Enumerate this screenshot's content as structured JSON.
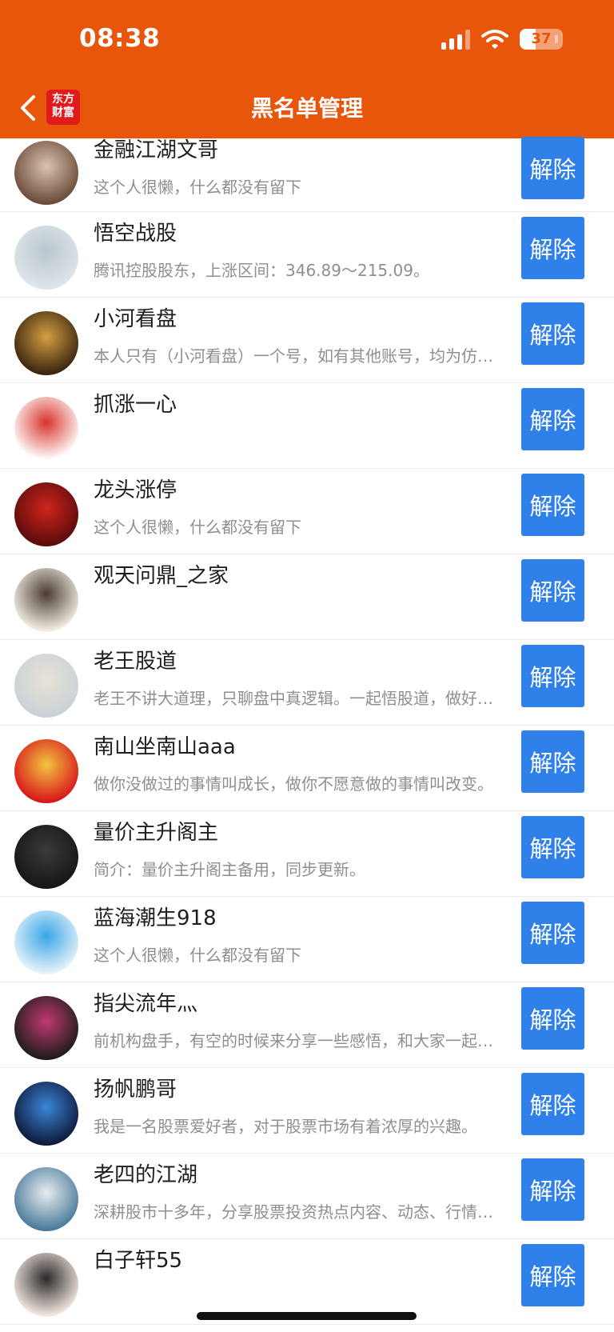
{
  "status": {
    "time": "08:38",
    "battery": "37",
    "battery_level": 0.37
  },
  "header": {
    "title": "黑名单管理",
    "logo_line1": "东方",
    "logo_line2": "财富"
  },
  "button_label": "解除",
  "users": [
    {
      "name": "金融江湖文哥",
      "desc": "这个人很懒，什么都没有留下",
      "avatar_colors": [
        "#6b4a3a",
        "#d9c4b0"
      ]
    },
    {
      "name": "悟空战股",
      "desc": "腾讯控股股东，上涨区间：346.89～215.09。",
      "avatar_colors": [
        "#dfe6ea",
        "#b9c6cf"
      ]
    },
    {
      "name": "小河看盘",
      "desc": "本人只有（小河看盘）一个号，如有其他账号，均为仿冒。",
      "avatar_colors": [
        "#3a2410",
        "#d4a040"
      ]
    },
    {
      "name": "抓涨一心",
      "desc": "",
      "avatar_colors": [
        "#ffffff",
        "#d8342c"
      ]
    },
    {
      "name": "龙头涨停",
      "desc": "这个人很懒，什么都没有留下",
      "avatar_colors": [
        "#5a0c0c",
        "#d0241c"
      ]
    },
    {
      "name": "观天问鼎_之家",
      "desc": "",
      "avatar_colors": [
        "#f3efe4",
        "#4a3c30"
      ]
    },
    {
      "name": "老王股道",
      "desc": "老王不讲大道理，只聊盘中真逻辑。一起悟股道，做好交易。",
      "avatar_colors": [
        "#c9d2d8",
        "#e8e2d4"
      ]
    },
    {
      "name": "南山坐南山aaa",
      "desc": "做你没做过的事情叫成长，做你不愿意做的事情叫改变。",
      "avatar_colors": [
        "#d8161a",
        "#f2c440"
      ]
    },
    {
      "name": "量价主升阁主",
      "desc": "简介：量价主升阁主备用，同步更新。",
      "avatar_colors": [
        "#161616",
        "#3a3a3a"
      ]
    },
    {
      "name": "蓝海潮生918",
      "desc": "这个人很懒，什么都没有留下",
      "avatar_colors": [
        "#e6f3fb",
        "#3aa6e6"
      ]
    },
    {
      "name": "指尖流年灬",
      "desc": "前机构盘手，有空的时候来分享一些感悟，和大家一起进步。",
      "avatar_colors": [
        "#1c1c1c",
        "#c23a70"
      ]
    },
    {
      "name": "扬帆鹏哥",
      "desc": "我是一名股票爱好者，对于股票市场有着浓厚的兴趣。",
      "avatar_colors": [
        "#0e1a3c",
        "#3a86d6"
      ]
    },
    {
      "name": "老四的江湖",
      "desc": "深耕股市十多年，分享股票投资热点内容、动态、行情分析。",
      "avatar_colors": [
        "#4a7a9a",
        "#e8ecef"
      ]
    },
    {
      "name": "白子轩55",
      "desc": "",
      "avatar_colors": [
        "#f6e8e0",
        "#2a2a2a"
      ]
    }
  ]
}
